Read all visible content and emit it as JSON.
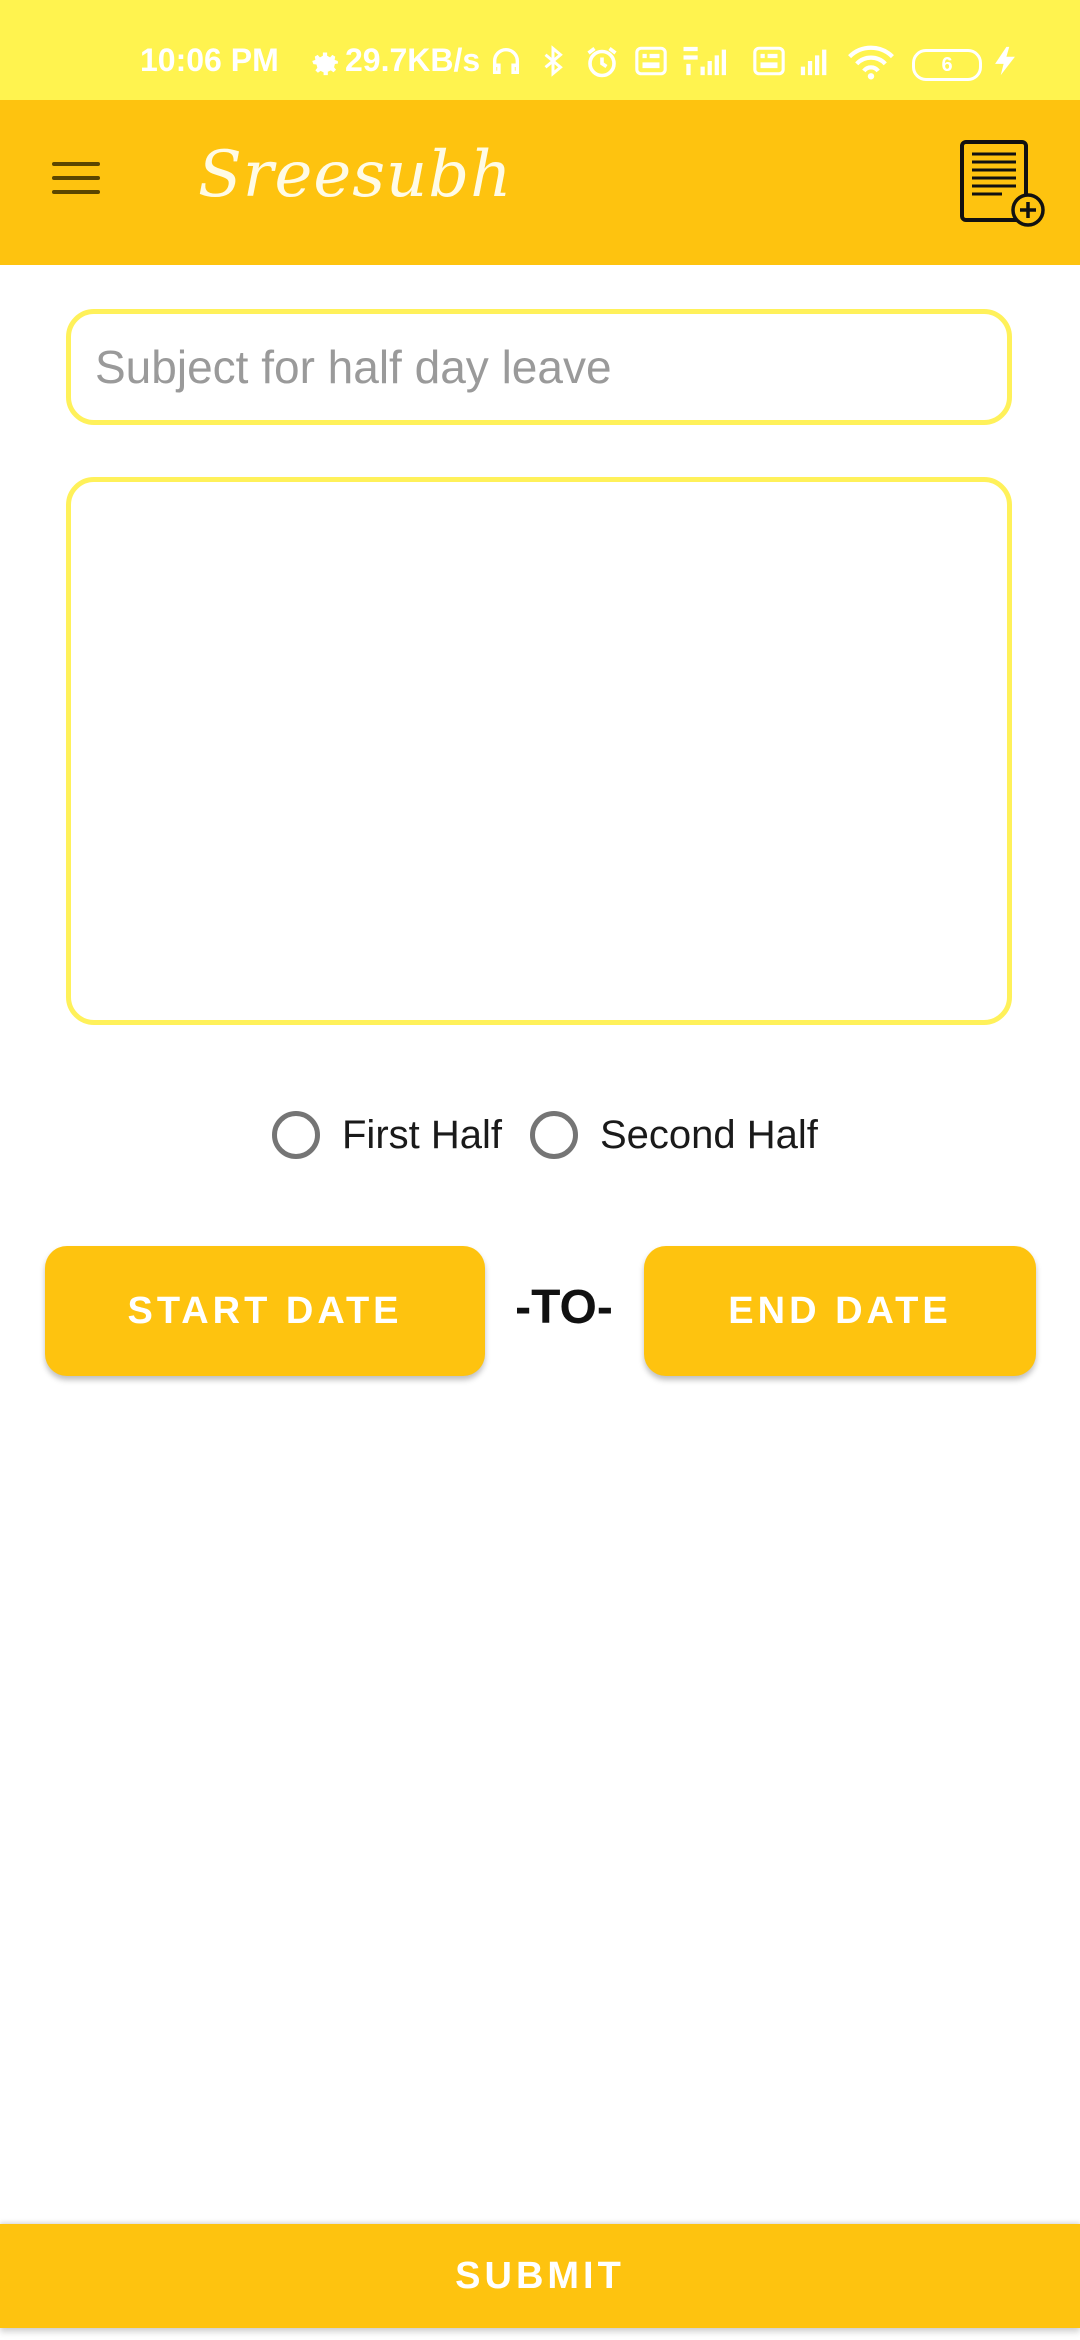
{
  "status_bar": {
    "time": "10:06 PM",
    "net_speed": "29.7KB/s",
    "battery": "6",
    "icons": [
      "gear-icon",
      "headset-icon",
      "bluetooth-icon",
      "alarm-icon",
      "volte-icon",
      "signal-4g-icon",
      "volte-icon",
      "signal-icon",
      "wifi-icon",
      "battery-icon",
      "charging-icon"
    ]
  },
  "app_bar": {
    "title": "Sreesubh",
    "menu_icon": "hamburger-menu-icon",
    "action_icon": "document-add-icon"
  },
  "form": {
    "subject_placeholder": "Subject for half day leave",
    "subject_value": "",
    "body_value": "",
    "radio_options": [
      {
        "label": "First Half",
        "checked": false
      },
      {
        "label": "Second Half",
        "checked": false
      }
    ],
    "start_date_label": "START DATE",
    "to_label": "-TO-",
    "end_date_label": "END DATE",
    "submit_label": "SUBMIT"
  },
  "colors": {
    "status_bar": "#FFF34F",
    "accent": "#FEC30F",
    "input_border": "#FFF15A",
    "button_text": "#FFFFFF"
  }
}
